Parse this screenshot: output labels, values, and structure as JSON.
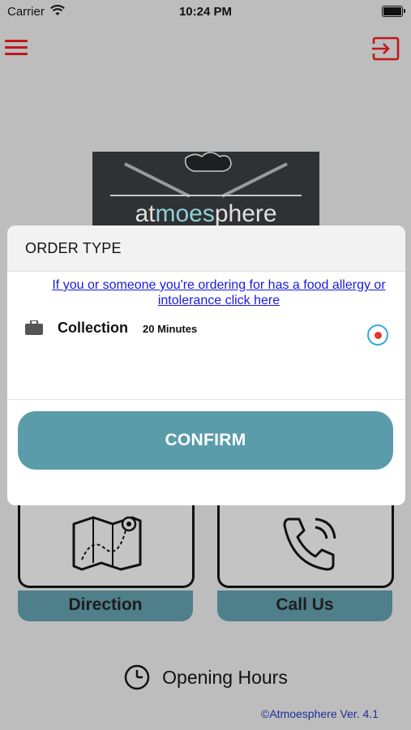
{
  "status_bar": {
    "carrier": "Carrier",
    "time": "10:24 PM"
  },
  "header": {
    "menu_icon": "hamburger-menu-icon",
    "logout_icon": "sign-out-icon",
    "accent_color": "#c0161a"
  },
  "logo": {
    "text_part1": "at",
    "text_accent": "moes",
    "text_part2": "phere"
  },
  "tiles": [
    {
      "label": "Direction",
      "icon": "map-route-icon"
    },
    {
      "label": "Call Us",
      "icon": "phone-icon"
    }
  ],
  "opening_hours": {
    "label": "Opening Hours",
    "icon": "clock-icon"
  },
  "version": "©Atmoesphere Ver. 4.1",
  "modal": {
    "title": "ORDER TYPE",
    "allergy_link": "If you or someone you're ordering for has a food allergy or intolerance click here",
    "options": [
      {
        "icon": "briefcase-icon",
        "name": "Collection",
        "time": "20 Minutes",
        "selected": true
      }
    ],
    "confirm_label": "CONFIRM",
    "confirm_color": "#5a9ca9"
  }
}
